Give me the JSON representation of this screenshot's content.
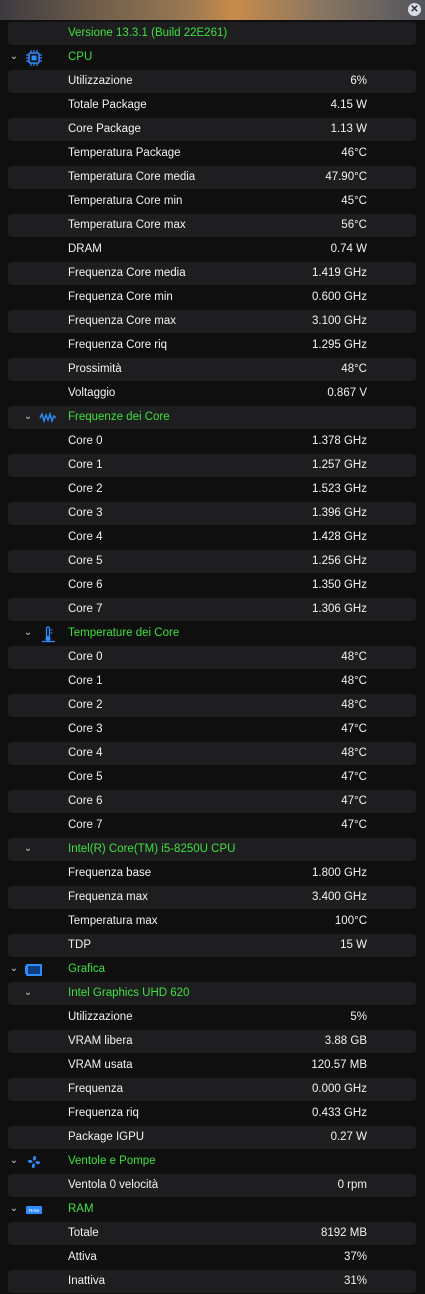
{
  "window": {
    "close_glyph": "✕"
  },
  "version": "Versione 13.3.1 (Build 22E261)",
  "cpu": {
    "title": "CPU",
    "rows": [
      {
        "label": "Utilizzazione",
        "value": "6%"
      },
      {
        "label": "Totale Package",
        "value": "4.15 W"
      },
      {
        "label": "Core Package",
        "value": "1.13 W"
      },
      {
        "label": "Temperatura Package",
        "value": "46°C"
      },
      {
        "label": "Temperatura Core media",
        "value": "47.90°C"
      },
      {
        "label": "Temperatura Core min",
        "value": "45°C"
      },
      {
        "label": "Temperatura Core max",
        "value": "56°C"
      },
      {
        "label": "DRAM",
        "value": "0.74 W"
      },
      {
        "label": "Frequenza Core media",
        "value": "1.419 GHz"
      },
      {
        "label": "Frequenza Core min",
        "value": "0.600 GHz"
      },
      {
        "label": "Frequenza Core max",
        "value": "3.100 GHz"
      },
      {
        "label": "Frequenza Core riq",
        "value": "1.295 GHz"
      },
      {
        "label": "Prossimità",
        "value": "48°C"
      },
      {
        "label": "Voltaggio",
        "value": "0.867 V"
      }
    ]
  },
  "core_freq": {
    "title": "Frequenze dei Core",
    "rows": [
      {
        "label": "Core 0",
        "value": "1.378 GHz"
      },
      {
        "label": "Core 1",
        "value": "1.257 GHz"
      },
      {
        "label": "Core 2",
        "value": "1.523 GHz"
      },
      {
        "label": "Core 3",
        "value": "1.396 GHz"
      },
      {
        "label": "Core 4",
        "value": "1.428 GHz"
      },
      {
        "label": "Core 5",
        "value": "1.256 GHz"
      },
      {
        "label": "Core 6",
        "value": "1.350 GHz"
      },
      {
        "label": "Core 7",
        "value": "1.306 GHz"
      }
    ]
  },
  "core_temp": {
    "title": "Temperature dei Core",
    "rows": [
      {
        "label": "Core 0",
        "value": "48°C"
      },
      {
        "label": "Core 1",
        "value": "48°C"
      },
      {
        "label": "Core 2",
        "value": "48°C"
      },
      {
        "label": "Core 3",
        "value": "47°C"
      },
      {
        "label": "Core 4",
        "value": "48°C"
      },
      {
        "label": "Core 5",
        "value": "47°C"
      },
      {
        "label": "Core 6",
        "value": "47°C"
      },
      {
        "label": "Core 7",
        "value": "47°C"
      }
    ]
  },
  "cpu_model": {
    "title": "Intel(R) Core(TM) i5-8250U CPU",
    "rows": [
      {
        "label": "Frequenza base",
        "value": "1.800 GHz"
      },
      {
        "label": "Frequenza max",
        "value": "3.400 GHz"
      },
      {
        "label": "Temperatura max",
        "value": "100°C"
      },
      {
        "label": "TDP",
        "value": "15 W"
      }
    ]
  },
  "graphics": {
    "title": "Grafica"
  },
  "gpu": {
    "title": "Intel Graphics UHD 620",
    "rows": [
      {
        "label": "Utilizzazione",
        "value": "5%"
      },
      {
        "label": "VRAM libera",
        "value": "3.88 GB"
      },
      {
        "label": "VRAM usata",
        "value": "120.57 MB"
      },
      {
        "label": "Frequenza",
        "value": "0.000 GHz"
      },
      {
        "label": "Frequenza riq",
        "value": "0.433 GHz"
      },
      {
        "label": "Package IGPU",
        "value": "0.27 W"
      }
    ]
  },
  "fans": {
    "title": "Ventole e Pompe",
    "rows": [
      {
        "label": "Ventola 0 velocità",
        "value": "0 rpm"
      }
    ]
  },
  "ram": {
    "title": "RAM",
    "icon_text": "RAM",
    "rows": [
      {
        "label": "Totale",
        "value": "8192 MB"
      },
      {
        "label": "Attiva",
        "value": "37%"
      },
      {
        "label": "Inattiva",
        "value": "31%"
      }
    ]
  },
  "colors": {
    "accent_green": "#3ee03e",
    "icon_blue": "#2f8cff"
  },
  "icons": {
    "cpu": "cpu-chip-icon",
    "core_freq": "waveform-icon",
    "core_temp": "thermometer-icon",
    "graphics": "display-icon",
    "fans": "fan-icon",
    "ram": "ram-icon"
  }
}
